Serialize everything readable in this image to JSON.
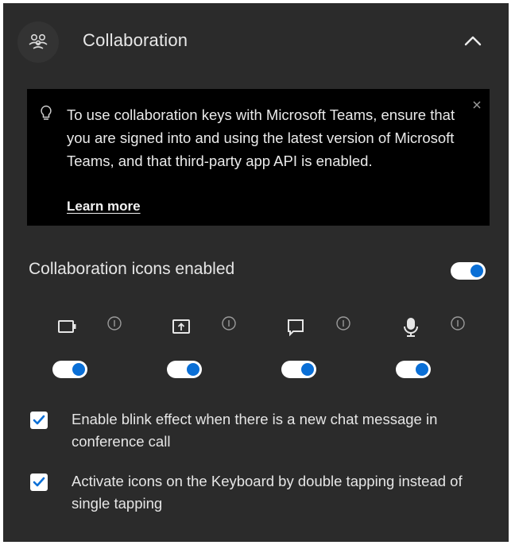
{
  "header": {
    "title": "Collaboration",
    "icon": "people-collaboration-icon",
    "collapse_icon": "chevron-up-icon"
  },
  "notice": {
    "text": "To use collaboration keys with Microsoft Teams, ensure that you are signed into and using the latest version of Microsoft Teams, and that third-party app API is enabled.",
    "link": "Learn more",
    "icon": "lightbulb-icon"
  },
  "collab_icons": {
    "label": "Collaboration icons enabled",
    "enabled": true,
    "items": [
      {
        "icon": "video-camera-icon",
        "enabled": true
      },
      {
        "icon": "share-screen-icon",
        "enabled": true
      },
      {
        "icon": "chat-icon",
        "enabled": true
      },
      {
        "icon": "microphone-icon",
        "enabled": true
      }
    ]
  },
  "options": [
    {
      "label": "Enable blink effect when there is a new chat message in conference call",
      "checked": true
    },
    {
      "label": "Activate icons on the Keyboard by double tapping instead of single tapping",
      "checked": true
    }
  ],
  "colors": {
    "panel_bg": "#2b2b2b",
    "notice_bg": "#000000",
    "accent": "#0a6fd6"
  }
}
